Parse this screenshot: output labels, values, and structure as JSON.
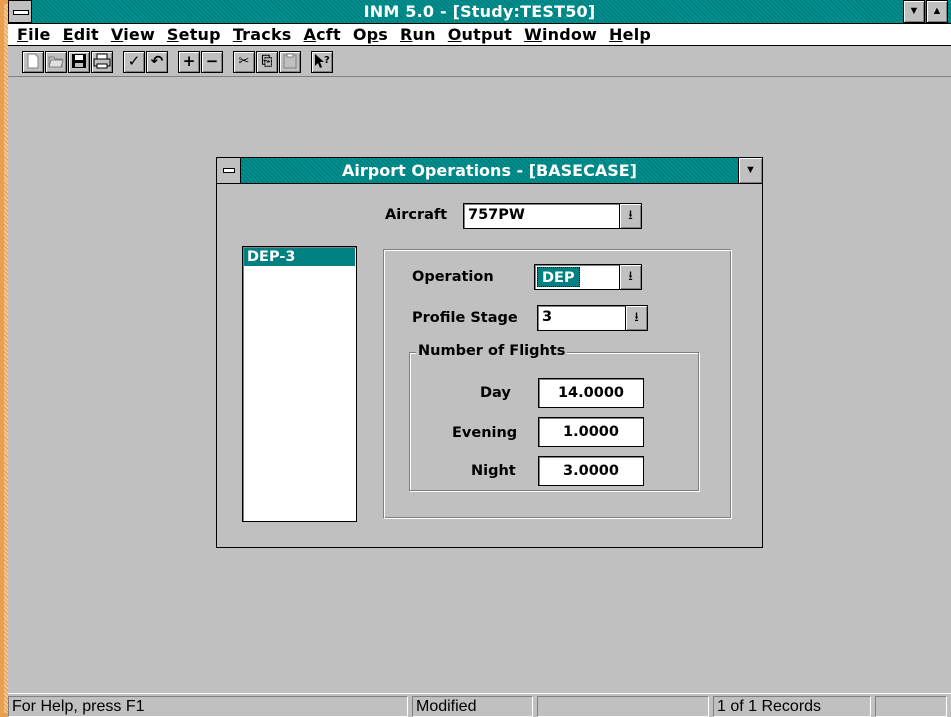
{
  "app": {
    "title": "INM 5.0 - [Study:TEST50]"
  },
  "menu": [
    {
      "label": "File",
      "mnemonic": "F",
      "rest": "ile"
    },
    {
      "label": "Edit",
      "mnemonic": "E",
      "rest": "dit"
    },
    {
      "label": "View",
      "mnemonic": "V",
      "rest": "iew"
    },
    {
      "label": "Setup",
      "mnemonic": "S",
      "rest": "etup"
    },
    {
      "label": "Tracks",
      "mnemonic": "T",
      "rest": "racks"
    },
    {
      "label": "Acft",
      "mnemonic": "A",
      "rest": "cft"
    },
    {
      "label": "Ops",
      "pre": "O",
      "mnemonic": "p",
      "rest": "s"
    },
    {
      "label": "Run",
      "mnemonic": "R",
      "rest": "un"
    },
    {
      "label": "Output",
      "mnemonic": "O",
      "rest": "utput"
    },
    {
      "label": "Window",
      "mnemonic": "W",
      "rest": "indow"
    },
    {
      "label": "Help",
      "mnemonic": "H",
      "rest": "elp"
    }
  ],
  "toolbar": {
    "new_icon": "new-document-icon",
    "open_icon": "open-folder-icon",
    "save_icon": "save-disk-icon",
    "print_icon": "printer-icon",
    "check_glyph": "✓",
    "undo_glyph": "↶",
    "plus_glyph": "+",
    "minus_glyph": "−",
    "cut_glyph": "✂",
    "copy_glyph": "⎘",
    "paste_glyph": "📋",
    "help_glyph": "?"
  },
  "dialog": {
    "title": "Airport Operations - [BASECASE]",
    "aircraft_label": "Aircraft",
    "aircraft_value": "757PW",
    "list_items": [
      "DEP-3"
    ],
    "operation_label": "Operation",
    "operation_value": "DEP",
    "profile_stage_label": "Profile Stage",
    "profile_stage_value": "3",
    "flights_group_label": "Number of Flights",
    "day_label": "Day",
    "day_value": "14.0000",
    "evening_label": "Evening",
    "evening_value": "1.0000",
    "night_label": "Night",
    "night_value": "3.0000"
  },
  "statusbar": {
    "help_text": "For Help, press F1",
    "modified_text": "Modified",
    "empty_text": "",
    "records_text": "1 of 1  Records",
    "last_text": ""
  },
  "colors": {
    "title_active": "#008080",
    "face": "#c0c0c0",
    "frame": "#e8a050"
  }
}
